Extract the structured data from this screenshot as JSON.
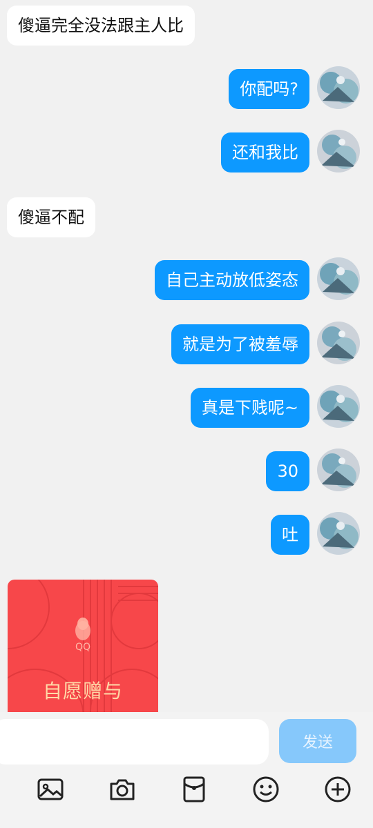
{
  "messages": [
    {
      "side": "left",
      "text": "傻逼完全没法跟主人比"
    },
    {
      "side": "right",
      "text": "你配吗?"
    },
    {
      "side": "right",
      "text": "还和我比"
    },
    {
      "side": "left",
      "text": "傻逼不配"
    },
    {
      "side": "right",
      "text": "自己主动放低姿态"
    },
    {
      "side": "right",
      "text": "就是为了被羞辱"
    },
    {
      "side": "right",
      "text": "真是下贱呢~"
    },
    {
      "side": "right",
      "text": "30"
    },
    {
      "side": "right",
      "text": "吐"
    }
  ],
  "red_packet": {
    "brand": "QQ",
    "title": "自愿赠与"
  },
  "input_bar": {
    "value": "",
    "send_label": "发送"
  },
  "toolbar": {
    "icons": [
      "image-icon",
      "camera-icon",
      "red-packet-icon",
      "emoji-icon",
      "plus-icon"
    ]
  },
  "colors": {
    "background": "#f1f1f1",
    "bubble_sent": "#0d99ff",
    "bubble_received": "#ffffff",
    "red_packet": "#f7474a",
    "send_button": "#86c8fb"
  }
}
